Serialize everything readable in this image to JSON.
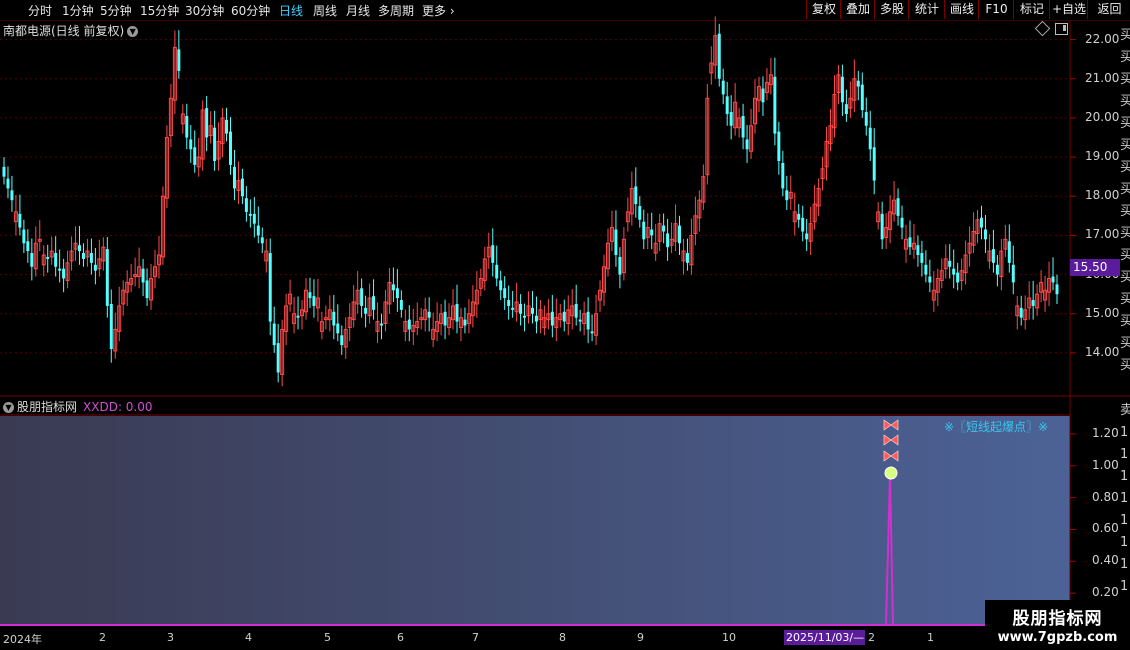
{
  "toolbar": {
    "periods": [
      "分时",
      "1分钟",
      "5分钟",
      "15分钟",
      "30分钟",
      "60分钟",
      "日线",
      "周线",
      "月线",
      "多周期",
      "更多"
    ],
    "active_period": "日线",
    "right_buttons": [
      "复权",
      "叠加",
      "多股",
      "统计",
      "画线",
      "F10",
      "标记",
      "+自选",
      "返回"
    ]
  },
  "main_chart": {
    "title": "南都电源(日线 前复权)",
    "y_ticks": [
      "22.00",
      "21.00",
      "20.00",
      "19.00",
      "18.00",
      "17.00",
      "16.00",
      "15.00",
      "14.00"
    ],
    "current_price": "15.50"
  },
  "indicator": {
    "title": "股朋指标网",
    "xxdd": "XXDD: 0.00",
    "signal_label": "※〖短线起爆点〗※",
    "y_ticks": [
      "1.20",
      "1.00",
      "0.80",
      "0.60",
      "0.40",
      "0.20"
    ]
  },
  "x_axis": {
    "ticks": [
      "2024年",
      "2",
      "3",
      "4",
      "5",
      "6",
      "7",
      "8",
      "9",
      "10",
      "2",
      "1"
    ],
    "selected_date": "2025/11/03/—"
  },
  "watermark": {
    "line1": "股朋指标网",
    "line2": "www.7gpzb.com"
  },
  "colors": {
    "up": "#ff4a4a",
    "down": "#54ffff",
    "signal": "#d030d0",
    "grid": "#5a0000",
    "accent": "#5a1c9a"
  },
  "chart_data": {
    "type": "candlestick",
    "title": "南都电源(日线 前复权)",
    "ylim": [
      12.9,
      22.5
    ],
    "close": [
      18.5,
      18.2,
      17.9,
      17.6,
      17.2,
      16.8,
      16.6,
      16.2,
      16.8,
      16.9,
      16.5,
      16.4,
      16.6,
      16.2,
      16.1,
      15.9,
      16.3,
      16.6,
      16.8,
      16.6,
      16.4,
      16.6,
      16.3,
      16.1,
      16.4,
      16.7,
      15.2,
      14.1,
      14.6,
      15.2,
      15.6,
      15.8,
      15.9,
      16.0,
      16.2,
      15.8,
      15.4,
      15.9,
      16.2,
      16.5,
      18.0,
      19.5,
      20.5,
      21.8,
      21.2,
      20.1,
      19.5,
      19.2,
      18.8,
      19.0,
      20.2,
      19.5,
      19.8,
      18.9,
      19.4,
      20.0,
      19.6,
      18.8,
      18.2,
      18.4,
      18.0,
      17.6,
      17.5,
      17.3,
      17.0,
      16.8,
      16.6,
      14.8,
      14.2,
      13.5,
      14.6,
      15.2,
      15.5,
      15.0,
      14.9,
      15.1,
      15.6,
      15.4,
      15.2,
      15.4,
      14.8,
      14.9,
      15.1,
      14.7,
      14.5,
      14.2,
      14.6,
      14.9,
      15.3,
      15.6,
      15.2,
      15.0,
      15.4,
      15.1,
      14.8,
      14.7,
      15.3,
      15.8,
      15.6,
      15.4,
      15.1,
      14.8,
      14.6,
      14.7,
      14.8,
      14.9,
      15.1,
      14.9,
      14.6,
      14.8,
      15.0,
      14.7,
      14.9,
      15.2,
      14.8,
      14.9,
      14.7,
      15.0,
      15.3,
      15.6,
      15.9,
      16.4,
      16.7,
      16.3,
      15.9,
      15.6,
      15.4,
      15.2,
      15.1,
      15.3,
      15.0,
      14.9,
      15.2,
      15.0,
      14.8,
      15.1,
      14.9,
      15.0,
      14.7,
      14.9,
      15.0,
      14.8,
      15.1,
      15.2,
      14.9,
      14.8,
      15.0,
      14.6,
      14.5,
      15.0,
      15.6,
      16.2,
      16.8,
      17.2,
      16.5,
      16.0,
      16.9,
      17.6,
      18.2,
      17.8,
      17.4,
      16.9,
      17.2,
      17.0,
      16.8,
      17.3,
      17.1,
      16.7,
      16.9,
      17.3,
      16.8,
      16.6,
      16.3,
      17.0,
      17.5,
      17.9,
      18.5,
      20.5,
      21.4,
      22.1,
      21.0,
      20.6,
      20.1,
      19.8,
      20.4,
      20.0,
      19.5,
      19.2,
      19.8,
      20.5,
      20.8,
      20.4,
      20.9,
      21.1,
      19.6,
      18.9,
      18.2,
      17.9,
      18.1,
      17.6,
      17.4,
      17.1,
      16.9,
      17.3,
      17.8,
      18.2,
      18.7,
      19.4,
      19.8,
      20.6,
      21.1,
      20.4,
      20.1,
      20.5,
      21.0,
      20.8,
      20.2,
      19.8,
      19.2,
      18.4,
      17.6,
      16.9,
      17.2,
      17.6,
      17.9,
      17.5,
      17.2,
      16.9,
      16.7,
      16.8,
      16.5,
      16.3,
      16.0,
      15.8,
      15.6,
      15.9,
      16.1,
      16.4,
      16.2,
      16.0,
      15.8,
      16.1,
      16.5,
      16.8,
      17.1,
      17.4,
      17.2,
      16.9,
      16.6,
      16.3,
      16.0,
      16.6,
      16.9,
      16.3,
      15.8,
      15.2,
      14.9,
      15.1,
      15.4,
      15.2,
      15.5,
      15.8,
      15.6,
      15.9,
      15.8,
      15.5
    ]
  }
}
